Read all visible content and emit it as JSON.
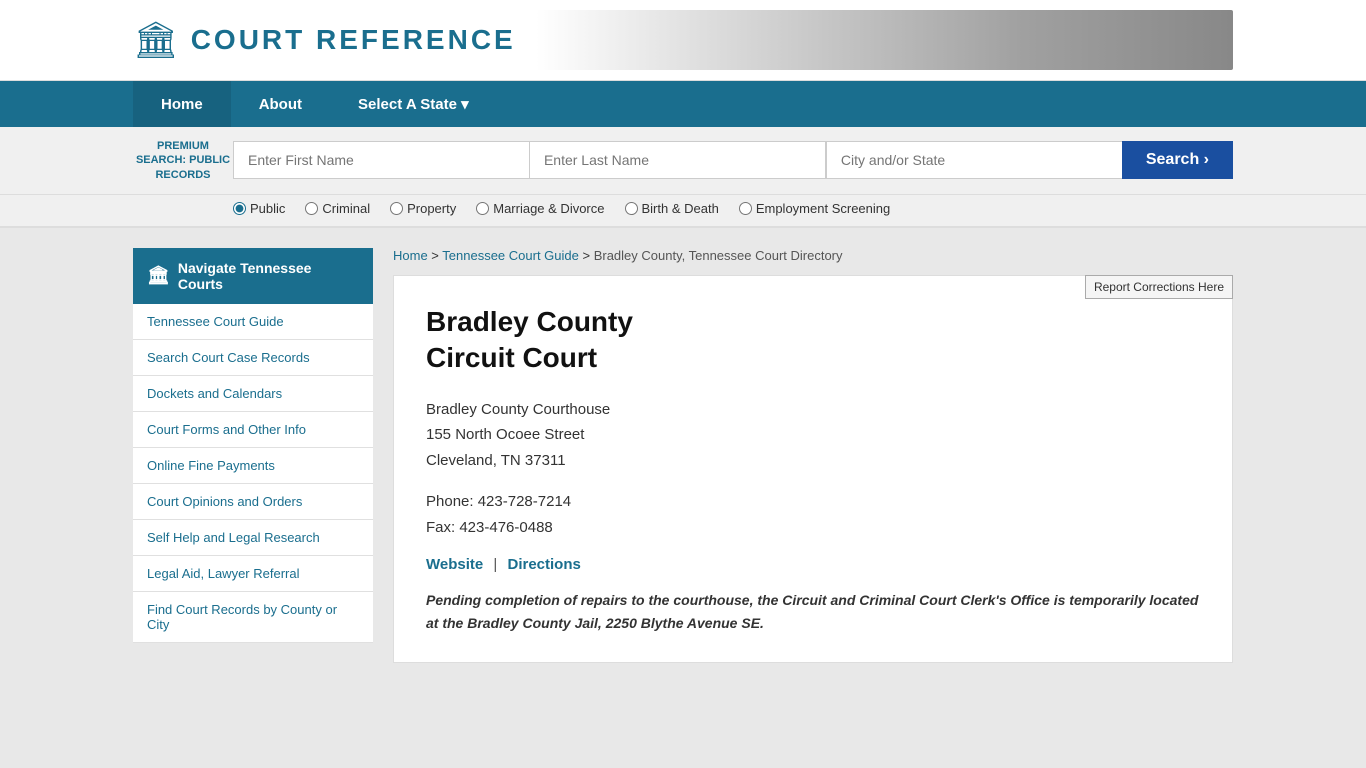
{
  "header": {
    "logo_text": "COURT REFERENCE",
    "logo_icon": "🏛"
  },
  "nav": {
    "items": [
      {
        "label": "Home",
        "active": true
      },
      {
        "label": "About",
        "active": false
      },
      {
        "label": "Select A State ▾",
        "active": false
      }
    ]
  },
  "search_bar": {
    "premium_label": "PREMIUM SEARCH: PUBLIC RECORDS",
    "first_name_placeholder": "Enter First Name",
    "last_name_placeholder": "Enter Last Name",
    "city_placeholder": "City and/or State",
    "search_button": "Search  ›",
    "radio_options": [
      {
        "label": "Public",
        "checked": true
      },
      {
        "label": "Criminal",
        "checked": false
      },
      {
        "label": "Property",
        "checked": false
      },
      {
        "label": "Marriage & Divorce",
        "checked": false
      },
      {
        "label": "Birth & Death",
        "checked": false
      },
      {
        "label": "Employment Screening",
        "checked": false
      }
    ]
  },
  "breadcrumb": {
    "home": "Home",
    "guide": "Tennessee Court Guide",
    "current": "Bradley County, Tennessee Court Directory"
  },
  "sidebar": {
    "heading": "Navigate Tennessee Courts",
    "links": [
      "Tennessee Court Guide",
      "Search Court Case Records",
      "Dockets and Calendars",
      "Court Forms and Other Info",
      "Online Fine Payments",
      "Court Opinions and Orders",
      "Self Help and Legal Research",
      "Legal Aid, Lawyer Referral",
      "Find Court Records by County or City"
    ]
  },
  "court": {
    "title_line1": "Bradley County",
    "title_line2": "Circuit Court",
    "address_line1": "Bradley County Courthouse",
    "address_line2": "155 North Ocoee Street",
    "address_line3": "Cleveland, TN 37311",
    "phone": "Phone: 423-728-7214",
    "fax": "Fax: 423-476-0488",
    "website_label": "Website",
    "directions_label": "Directions",
    "separator": "|",
    "notice": "Pending completion of repairs to the courthouse, the Circuit and Criminal Court Clerk's Office is temporarily located at the Bradley County Jail, 2250 Blythe Avenue SE.",
    "report_btn": "Report Corrections Here"
  }
}
